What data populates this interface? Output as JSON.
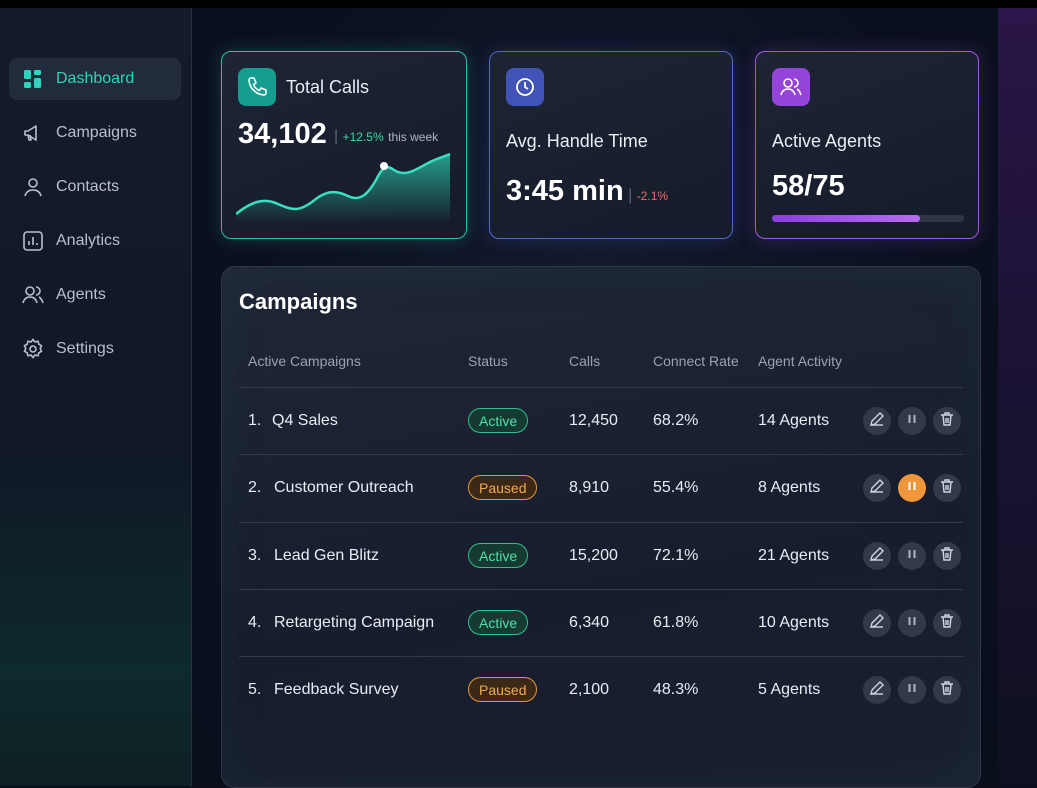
{
  "nav": {
    "items": [
      {
        "label": "Dashboard",
        "icon": "dashboard-icon",
        "active": true
      },
      {
        "label": "Campaigns",
        "icon": "megaphone-icon"
      },
      {
        "label": "Contacts",
        "icon": "user-icon"
      },
      {
        "label": "Analytics",
        "icon": "analytics-icon"
      },
      {
        "label": "Agents",
        "icon": "users-icon"
      },
      {
        "label": "Settings",
        "icon": "gear-icon"
      }
    ]
  },
  "stats": {
    "total_calls": {
      "title": "Total Calls",
      "value": "34,102",
      "delta": "+12.5%",
      "delta_suffix": "this week",
      "icon": "phone-icon"
    },
    "handle_time": {
      "title": "Avg. Handle Time",
      "value": "3:45 min",
      "delta": "-2.1%",
      "icon": "clock-icon"
    },
    "active_agents": {
      "title": "Active Agents",
      "value": "58/75",
      "progress": 0.77,
      "icon": "users-icon"
    }
  },
  "campaigns": {
    "title": "Campaigns",
    "columns": [
      "Active Campaigns",
      "Status",
      "Calls",
      "Connect Rate",
      "Agent Activity"
    ],
    "rows": [
      {
        "num": "1.",
        "name": "Q4 Sales",
        "status": "Active",
        "calls": "12,450",
        "rate": "68.2%",
        "agents": "14 Agents"
      },
      {
        "num": "2.",
        "name": "Customer Outreach",
        "status": "Paused",
        "calls": "8,910",
        "rate": "55.4%",
        "agents": "8 Agents"
      },
      {
        "num": "3.",
        "name": "Lead Gen Blitz",
        "status": "Active",
        "calls": "15,200",
        "rate": "72.1%",
        "agents": "21 Agents"
      },
      {
        "num": "4.",
        "name": "Retargeting Campaign",
        "status": "Active",
        "calls": "6,340",
        "rate": "61.8%",
        "agents": "10 Agents"
      },
      {
        "num": "5.",
        "name": "Feedback Survey",
        "status": "Paused",
        "calls": "2,100",
        "rate": "48.3%",
        "agents": "5 Agents"
      }
    ]
  },
  "colors": {
    "accent": "#2ad6bd",
    "active": "#4ee0a8",
    "paused": "#f2a950",
    "purple": "#a055e0"
  }
}
